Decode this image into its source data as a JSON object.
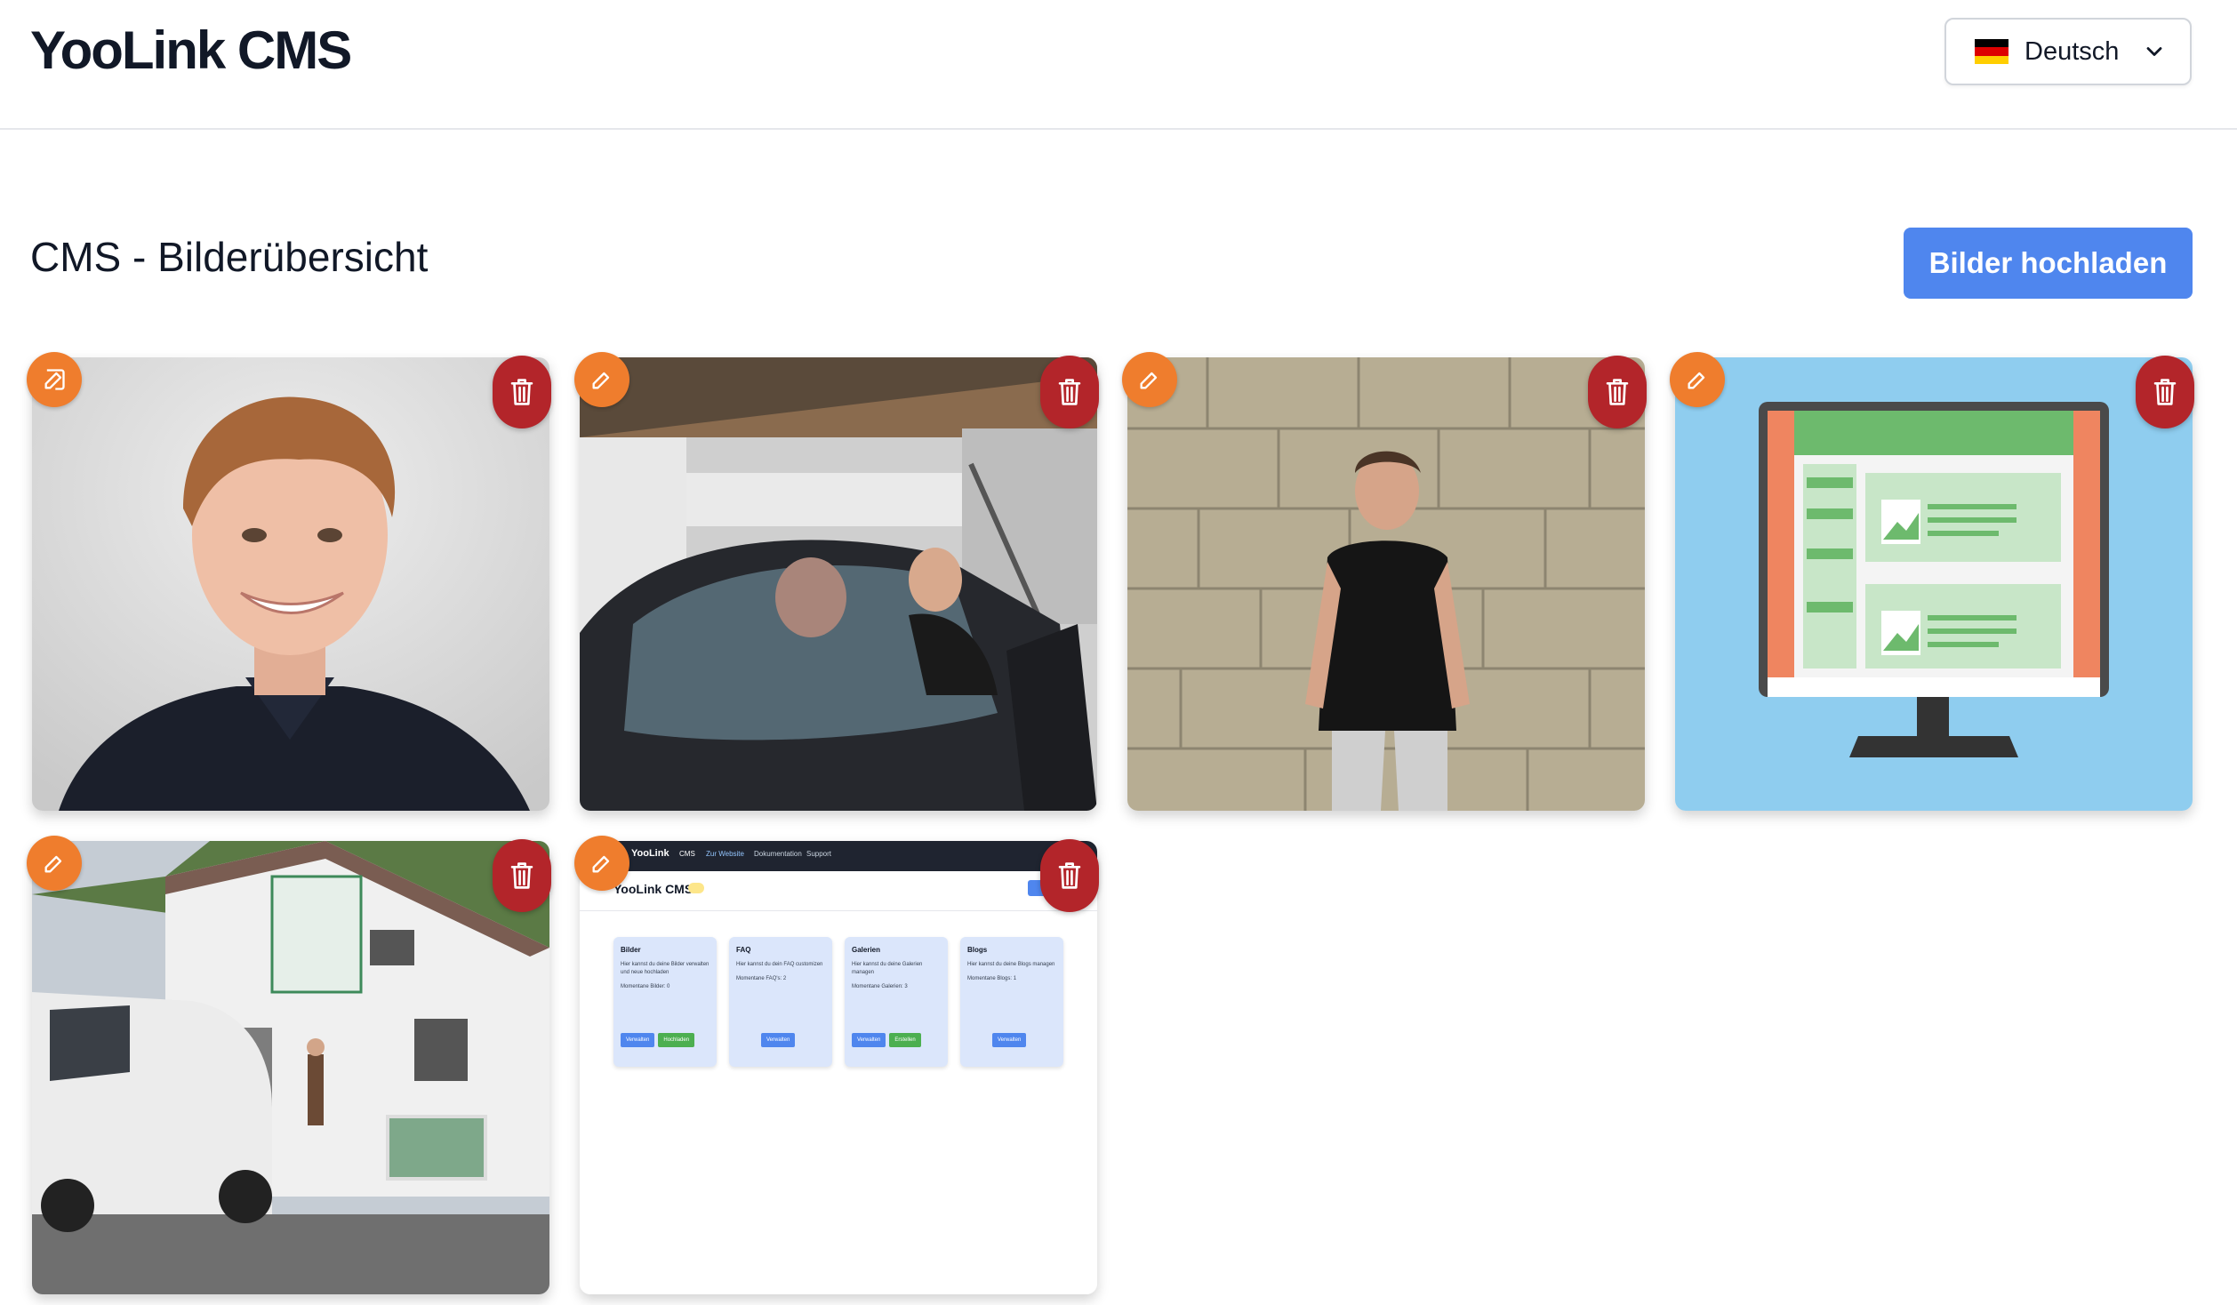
{
  "header": {
    "brand": "YooLink CMS",
    "language": {
      "label": "Deutsch",
      "flag": [
        "#000000",
        "#dd0000",
        "#ffce00"
      ]
    }
  },
  "main": {
    "title": "CMS - Bilderübersicht",
    "upload_label": "Bilder hochladen"
  },
  "colors": {
    "accent": "#4f86ee",
    "edit": "#ef7d2d",
    "delete": "#b3252a"
  },
  "images": [
    {
      "subject": "portrait of smiling young man"
    },
    {
      "subject": "two men inspecting car windshield in workshop"
    },
    {
      "subject": "young man in black polo in front of stone wall"
    },
    {
      "subject": "illustration of desktop monitor with website"
    },
    {
      "subject": "autoglas service building with van"
    },
    {
      "subject": "screenshot of YooLink CMS dashboard"
    }
  ],
  "dashboard_preview": {
    "brand": "YooLink",
    "nav": [
      "CMS",
      "Zur Website",
      "Dokumentation",
      "Support"
    ],
    "title": "YooLink CMS",
    "cards": [
      {
        "title": "Bilder",
        "text": "Hier kannst du deine Bilder verwalten und neue hochladen",
        "count": "Momentane Bilder: 0",
        "buttons": [
          "Verwalten",
          "Hochladen"
        ]
      },
      {
        "title": "FAQ",
        "text": "Hier kannst du dein FAQ customizen",
        "count": "Momentane FAQ's: 2",
        "buttons": [
          "Verwalten"
        ]
      },
      {
        "title": "Galerien",
        "text": "Hier kannst du deine Galerien managen",
        "count": "Momentane Galerien: 3",
        "buttons": [
          "Verwalten",
          "Erstellen"
        ]
      },
      {
        "title": "Blogs",
        "text": "Hier kannst du deine Blogs managen",
        "count": "Momentane Blogs: 1",
        "buttons": [
          "Verwalten"
        ]
      }
    ]
  }
}
